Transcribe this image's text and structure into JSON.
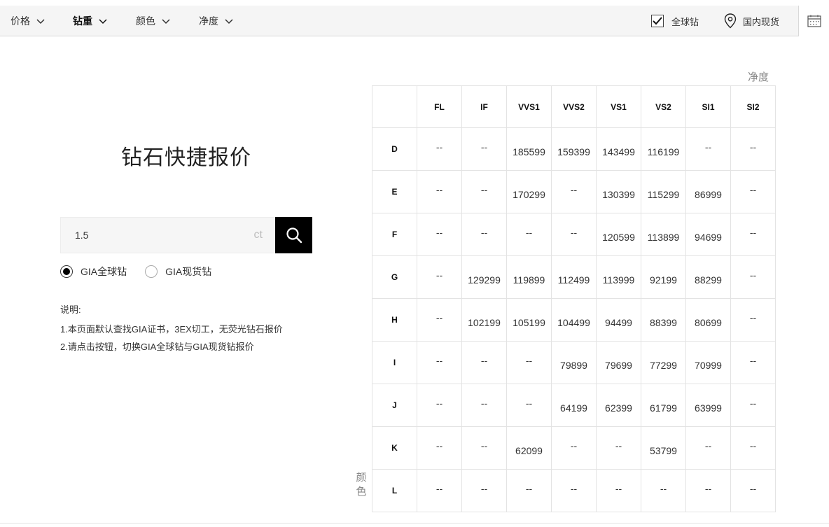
{
  "filters": [
    {
      "label": "价格",
      "active": false
    },
    {
      "label": "钻重",
      "active": true
    },
    {
      "label": "颜色",
      "active": false
    },
    {
      "label": "净度",
      "active": false
    }
  ],
  "global_checkbox": {
    "label": "全球钻",
    "checked": true
  },
  "stock_location": {
    "label": "国内现货",
    "icon": "location-pin-icon"
  },
  "calendar_icon": "calendar-icon",
  "title": "钻石快捷报价",
  "search": {
    "value": "1.5",
    "unit": "ct",
    "icon": "search-icon"
  },
  "radios": [
    {
      "label": "GIA全球钻",
      "selected": true
    },
    {
      "label": "GIA现货钻",
      "selected": false
    }
  ],
  "notes": {
    "heading": "说明:",
    "lines": [
      "1.本页面默认查找GIA证书，3EX切工，无荧光钻石报价",
      "2.请点击按钮，切换GIA全球钻与GIA现货钻报价"
    ]
  },
  "axis_clarity": "净度",
  "axis_color": "颜色",
  "table": {
    "columns": [
      "FL",
      "IF",
      "VVS1",
      "VVS2",
      "VS1",
      "VS2",
      "SI1",
      "SI2"
    ],
    "rows": [
      {
        "color": "D",
        "values": [
          "--",
          "--",
          "185599",
          "159399",
          "143499",
          "116199",
          "--",
          "--"
        ]
      },
      {
        "color": "E",
        "values": [
          "--",
          "--",
          "170299",
          "--",
          "130399",
          "115299",
          "86999",
          "--"
        ]
      },
      {
        "color": "F",
        "values": [
          "--",
          "--",
          "--",
          "--",
          "120599",
          "113899",
          "94699",
          "--"
        ]
      },
      {
        "color": "G",
        "values": [
          "--",
          "129299",
          "119899",
          "112499",
          "113999",
          "92199",
          "88299",
          "--"
        ]
      },
      {
        "color": "H",
        "values": [
          "--",
          "102199",
          "105199",
          "104499",
          "94499",
          "88399",
          "80699",
          "--"
        ]
      },
      {
        "color": "I",
        "values": [
          "--",
          "--",
          "--",
          "79899",
          "79699",
          "77299",
          "70999",
          "--"
        ]
      },
      {
        "color": "J",
        "values": [
          "--",
          "--",
          "--",
          "64199",
          "62399",
          "61799",
          "63999",
          "--"
        ]
      },
      {
        "color": "K",
        "values": [
          "--",
          "--",
          "62099",
          "--",
          "--",
          "53799",
          "--",
          "--"
        ]
      },
      {
        "color": "L",
        "values": [
          "--",
          "--",
          "--",
          "--",
          "--",
          "--",
          "--",
          "--"
        ]
      }
    ]
  }
}
